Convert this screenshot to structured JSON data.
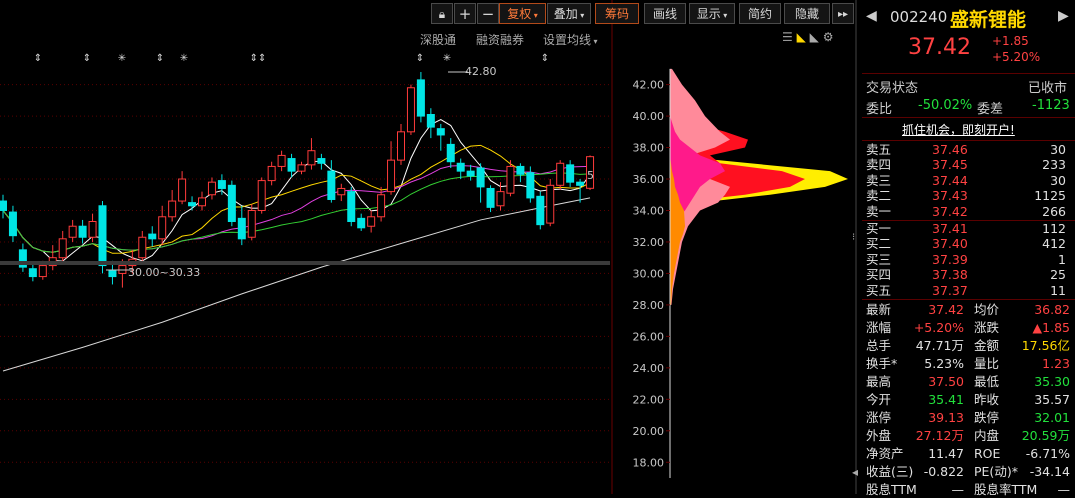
{
  "toolbar": {
    "buttons": [
      "复权",
      "叠加",
      "筹码",
      "画线",
      "显示",
      "简约",
      "隐藏"
    ],
    "lock_icon": "lock-icon",
    "plus_icon": "plus-icon",
    "minus_icon": "minus-icon",
    "more_icon": "double-chevron-right-icon"
  },
  "subbar": {
    "items": [
      "深股通",
      "融资融券",
      "设置均线"
    ]
  },
  "chart": {
    "price_high_label": "42.80",
    "price_low_label": "30.00~30.33",
    "last_price_label": "5",
    "y_ticks": [
      "42.00",
      "40.00",
      "38.00",
      "36.00",
      "34.00",
      "32.00",
      "30.00",
      "28.00",
      "26.00",
      "24.00",
      "22.00",
      "20.00",
      "18.00"
    ],
    "markers": [
      "⇕",
      "⇕",
      "✳",
      "⇕",
      "✳",
      "⇕⇕",
      "⇕",
      "✳",
      "⇕"
    ],
    "colors": {
      "up": "#ff3b3b",
      "down": "#00e5e5",
      "ma5": "#ffffff",
      "ma10": "#ffd800",
      "ma20": "#e040e0",
      "ma30": "#34d034",
      "ma60": "#d8d8d8"
    }
  },
  "quote": {
    "code": "002240",
    "name": "盛新锂能",
    "price": "37.42",
    "change": "+1.85",
    "change_pct": "+5.20%",
    "status_label": "交易状态",
    "status_value": "已收市",
    "weibi_label": "委比",
    "weibi_value": "-50.02%",
    "weicha_label": "委差",
    "weicha_value": "-1123",
    "promo": "抓住机会，即刻开户!"
  },
  "asks": [
    {
      "label": "卖五",
      "price": "37.46",
      "vol": "30"
    },
    {
      "label": "卖四",
      "price": "37.45",
      "vol": "233"
    },
    {
      "label": "卖三",
      "price": "37.44",
      "vol": "30"
    },
    {
      "label": "卖二",
      "price": "37.43",
      "vol": "1125"
    },
    {
      "label": "卖一",
      "price": "37.42",
      "vol": "266"
    }
  ],
  "bids": [
    {
      "label": "买一",
      "price": "37.41",
      "vol": "112"
    },
    {
      "label": "买二",
      "price": "37.40",
      "vol": "412"
    },
    {
      "label": "买三",
      "price": "37.39",
      "vol": "1"
    },
    {
      "label": "买四",
      "price": "37.38",
      "vol": "25"
    },
    {
      "label": "买五",
      "price": "37.37",
      "vol": "11"
    }
  ],
  "stats": [
    {
      "l1": "最新",
      "v1": "37.42",
      "c1": "red",
      "l2": "均价",
      "v2": "36.82",
      "c2": "red"
    },
    {
      "l1": "涨幅",
      "v1": "+5.20%",
      "c1": "red",
      "l2": "涨跌",
      "v2": "▲1.85",
      "c2": "red"
    },
    {
      "l1": "总手",
      "v1": "47.71万",
      "c1": "white",
      "l2": "金额",
      "v2": "17.56亿",
      "c2": "yel"
    },
    {
      "l1": "换手*",
      "v1": "5.23%",
      "c1": "white",
      "l2": "量比",
      "v2": "1.23",
      "c2": "red"
    },
    {
      "l1": "最高",
      "v1": "37.50",
      "c1": "red",
      "l2": "最低",
      "v2": "35.30",
      "c2": "green"
    },
    {
      "l1": "今开",
      "v1": "35.41",
      "c1": "green",
      "l2": "昨收",
      "v2": "35.57",
      "c2": "white"
    },
    {
      "l1": "涨停",
      "v1": "39.13",
      "c1": "red",
      "l2": "跌停",
      "v2": "32.01",
      "c2": "green"
    },
    {
      "l1": "外盘",
      "v1": "27.12万",
      "c1": "red",
      "l2": "内盘",
      "v2": "20.59万",
      "c2": "green"
    },
    {
      "l1": "净资产",
      "v1": "11.47",
      "c1": "white",
      "l2": "ROE",
      "v2": "-6.71%",
      "c2": "white"
    },
    {
      "l1": "收益(三)",
      "v1": "-0.822",
      "c1": "white",
      "l2": "PE(动)*",
      "v2": "-34.14",
      "c2": "white"
    },
    {
      "l1": "股息TTM",
      "v1": "—",
      "c1": "white",
      "l2": "股息率TTM",
      "v2": "—",
      "c2": "white"
    }
  ],
  "chart_data": {
    "type": "candlestick",
    "ylim": [
      17,
      43.5
    ],
    "candles": [
      {
        "o": 34.6,
        "c": 34.0,
        "h": 35.0,
        "l": 33.5
      },
      {
        "o": 33.9,
        "c": 32.4,
        "h": 34.3,
        "l": 32.0
      },
      {
        "o": 31.5,
        "c": 30.4,
        "h": 31.9,
        "l": 30.1
      },
      {
        "o": 30.3,
        "c": 29.8,
        "h": 30.6,
        "l": 29.5
      },
      {
        "o": 29.8,
        "c": 30.5,
        "h": 30.8,
        "l": 29.6
      },
      {
        "o": 30.5,
        "c": 31.0,
        "h": 31.8,
        "l": 30.2
      },
      {
        "o": 31.0,
        "c": 32.2,
        "h": 32.7,
        "l": 30.7
      },
      {
        "o": 32.3,
        "c": 33.0,
        "h": 33.4,
        "l": 32.0
      },
      {
        "o": 33.0,
        "c": 32.3,
        "h": 33.4,
        "l": 31.9
      },
      {
        "o": 32.3,
        "c": 33.3,
        "h": 33.8,
        "l": 32.0
      },
      {
        "o": 34.3,
        "c": 30.5,
        "h": 34.6,
        "l": 30.0
      },
      {
        "o": 30.2,
        "c": 29.8,
        "h": 30.8,
        "l": 29.3
      },
      {
        "o": 30.0,
        "c": 30.5,
        "h": 30.9,
        "l": 29.1
      },
      {
        "o": 30.5,
        "c": 30.9,
        "h": 31.5,
        "l": 30.0
      },
      {
        "o": 31.0,
        "c": 32.3,
        "h": 32.7,
        "l": 30.8
      },
      {
        "o": 32.5,
        "c": 32.2,
        "h": 33.0,
        "l": 31.7
      },
      {
        "o": 32.2,
        "c": 33.6,
        "h": 34.3,
        "l": 31.8
      },
      {
        "o": 33.6,
        "c": 34.6,
        "h": 35.3,
        "l": 33.3
      },
      {
        "o": 34.6,
        "c": 36.0,
        "h": 36.5,
        "l": 34.4
      },
      {
        "o": 34.5,
        "c": 34.3,
        "h": 34.9,
        "l": 34.0
      },
      {
        "o": 34.3,
        "c": 34.8,
        "h": 35.2,
        "l": 34.0
      },
      {
        "o": 35.0,
        "c": 35.8,
        "h": 36.1,
        "l": 34.7
      },
      {
        "o": 35.9,
        "c": 35.4,
        "h": 36.3,
        "l": 35.0
      },
      {
        "o": 35.6,
        "c": 33.3,
        "h": 35.9,
        "l": 33.0
      },
      {
        "o": 33.5,
        "c": 32.2,
        "h": 34.3,
        "l": 31.8
      },
      {
        "o": 32.3,
        "c": 34.0,
        "h": 34.4,
        "l": 32.1
      },
      {
        "o": 34.0,
        "c": 35.9,
        "h": 36.1,
        "l": 33.8
      },
      {
        "o": 35.9,
        "c": 36.8,
        "h": 37.1,
        "l": 35.6
      },
      {
        "o": 36.8,
        "c": 37.5,
        "h": 37.8,
        "l": 36.5
      },
      {
        "o": 37.3,
        "c": 36.5,
        "h": 37.6,
        "l": 36.1
      },
      {
        "o": 36.5,
        "c": 36.9,
        "h": 37.1,
        "l": 36.3
      },
      {
        "o": 36.9,
        "c": 37.8,
        "h": 38.6,
        "l": 36.6
      },
      {
        "o": 37.3,
        "c": 37.0,
        "h": 37.6,
        "l": 36.6
      },
      {
        "o": 36.5,
        "c": 34.7,
        "h": 37.2,
        "l": 34.5
      },
      {
        "o": 35.0,
        "c": 35.4,
        "h": 35.7,
        "l": 34.6
      },
      {
        "o": 35.2,
        "c": 33.3,
        "h": 35.5,
        "l": 33.0
      },
      {
        "o": 33.5,
        "c": 32.9,
        "h": 33.8,
        "l": 32.7
      },
      {
        "o": 33.0,
        "c": 33.6,
        "h": 34.0,
        "l": 32.6
      },
      {
        "o": 33.6,
        "c": 35.0,
        "h": 35.5,
        "l": 33.3
      },
      {
        "o": 35.2,
        "c": 37.2,
        "h": 38.4,
        "l": 35.0
      },
      {
        "o": 37.2,
        "c": 39.0,
        "h": 39.5,
        "l": 36.9
      },
      {
        "o": 39.0,
        "c": 41.8,
        "h": 42.0,
        "l": 38.8
      },
      {
        "o": 42.3,
        "c": 40.0,
        "h": 42.8,
        "l": 39.6
      },
      {
        "o": 40.1,
        "c": 39.3,
        "h": 40.5,
        "l": 38.6
      },
      {
        "o": 39.2,
        "c": 38.8,
        "h": 39.5,
        "l": 37.8
      },
      {
        "o": 38.2,
        "c": 37.1,
        "h": 38.6,
        "l": 36.7
      },
      {
        "o": 37.0,
        "c": 36.5,
        "h": 37.3,
        "l": 36.0
      },
      {
        "o": 36.5,
        "c": 36.2,
        "h": 36.9,
        "l": 35.9
      },
      {
        "o": 36.7,
        "c": 35.5,
        "h": 37.0,
        "l": 34.5
      },
      {
        "o": 35.4,
        "c": 34.2,
        "h": 35.6,
        "l": 33.9
      },
      {
        "o": 34.3,
        "c": 35.2,
        "h": 35.8,
        "l": 34.0
      },
      {
        "o": 35.1,
        "c": 36.8,
        "h": 37.2,
        "l": 34.9
      },
      {
        "o": 36.8,
        "c": 36.3,
        "h": 37.0,
        "l": 35.8
      },
      {
        "o": 36.4,
        "c": 34.8,
        "h": 36.8,
        "l": 34.5
      },
      {
        "o": 34.9,
        "c": 33.1,
        "h": 35.2,
        "l": 32.8
      },
      {
        "o": 33.2,
        "c": 35.6,
        "h": 36.0,
        "l": 33.0
      },
      {
        "o": 35.6,
        "c": 37.0,
        "h": 37.2,
        "l": 35.3
      },
      {
        "o": 36.9,
        "c": 35.8,
        "h": 37.2,
        "l": 35.5
      },
      {
        "o": 35.8,
        "c": 35.6,
        "h": 36.0,
        "l": 34.5
      },
      {
        "o": 35.41,
        "c": 37.42,
        "h": 37.5,
        "l": 35.3
      }
    ],
    "ma60": [
      [
        0,
        23.8
      ],
      [
        8,
        25.3
      ],
      [
        16,
        26.9
      ],
      [
        24,
        28.7
      ],
      [
        32,
        30.4
      ],
      [
        40,
        31.9
      ],
      [
        48,
        33.4
      ],
      [
        55,
        34.3
      ],
      [
        59,
        34.8
      ]
    ],
    "chip_distribution": [
      {
        "p": 28.0,
        "pink": 1.5,
        "red": 0,
        "yel": 0,
        "mag": 0,
        "org": 1
      },
      {
        "p": 29.0,
        "pink": 3,
        "red": 0,
        "yel": 0,
        "mag": 0,
        "org": 2
      },
      {
        "p": 30.0,
        "pink": 6,
        "red": 0,
        "yel": 0,
        "mag": 0,
        "org": 4
      },
      {
        "p": 31.0,
        "pink": 9,
        "red": 0,
        "yel": 0,
        "mag": 0,
        "org": 7
      },
      {
        "p": 32.0,
        "pink": 12,
        "red": 0,
        "yel": 0,
        "mag": 0,
        "org": 10
      },
      {
        "p": 32.5,
        "pink": 15,
        "red": 0,
        "yel": 0,
        "mag": 0,
        "org": 13
      },
      {
        "p": 33.0,
        "pink": 18,
        "red": 0,
        "yel": 0,
        "mag": 0,
        "org": 15
      },
      {
        "p": 34.0,
        "pink": 30,
        "red": 0,
        "yel": 0,
        "mag": 15,
        "org": 14
      },
      {
        "p": 34.5,
        "pink": 48,
        "red": 5,
        "yel": 30,
        "mag": 20,
        "org": 10
      },
      {
        "p": 35.0,
        "pink": 55,
        "red": 75,
        "yel": 100,
        "mag": 25,
        "org": 8
      },
      {
        "p": 35.5,
        "pink": 60,
        "red": 120,
        "yel": 155,
        "mag": 30,
        "org": 5
      },
      {
        "p": 36.0,
        "pink": 40,
        "red": 135,
        "yel": 178,
        "mag": 40,
        "org": 4
      },
      {
        "p": 36.5,
        "pink": 20,
        "red": 112,
        "yel": 160,
        "mag": 55,
        "org": 2
      },
      {
        "p": 37.0,
        "pink": 15,
        "red": 50,
        "yel": 80,
        "mag": 50,
        "org": 1
      },
      {
        "p": 37.5,
        "pink": 20,
        "red": 40,
        "yel": 0,
        "mag": 30,
        "org": 0
      },
      {
        "p": 38.0,
        "pink": 45,
        "red": 75,
        "yel": 0,
        "mag": 20,
        "org": 0
      },
      {
        "p": 38.5,
        "pink": 60,
        "red": 78,
        "yel": 0,
        "mag": 10,
        "org": 0
      },
      {
        "p": 39.0,
        "pink": 50,
        "red": 55,
        "yel": 0,
        "mag": 5,
        "org": 0
      },
      {
        "p": 40.0,
        "pink": 35,
        "red": 0,
        "yel": 0,
        "mag": 0,
        "org": 0
      },
      {
        "p": 41.0,
        "pink": 25,
        "red": 0,
        "yel": 0,
        "mag": 0,
        "org": 0
      },
      {
        "p": 42.0,
        "pink": 12,
        "red": 0,
        "yel": 0,
        "mag": 0,
        "org": 0
      },
      {
        "p": 43.0,
        "pink": 2,
        "red": 0,
        "yel": 0,
        "mag": 0,
        "org": 0
      }
    ]
  }
}
